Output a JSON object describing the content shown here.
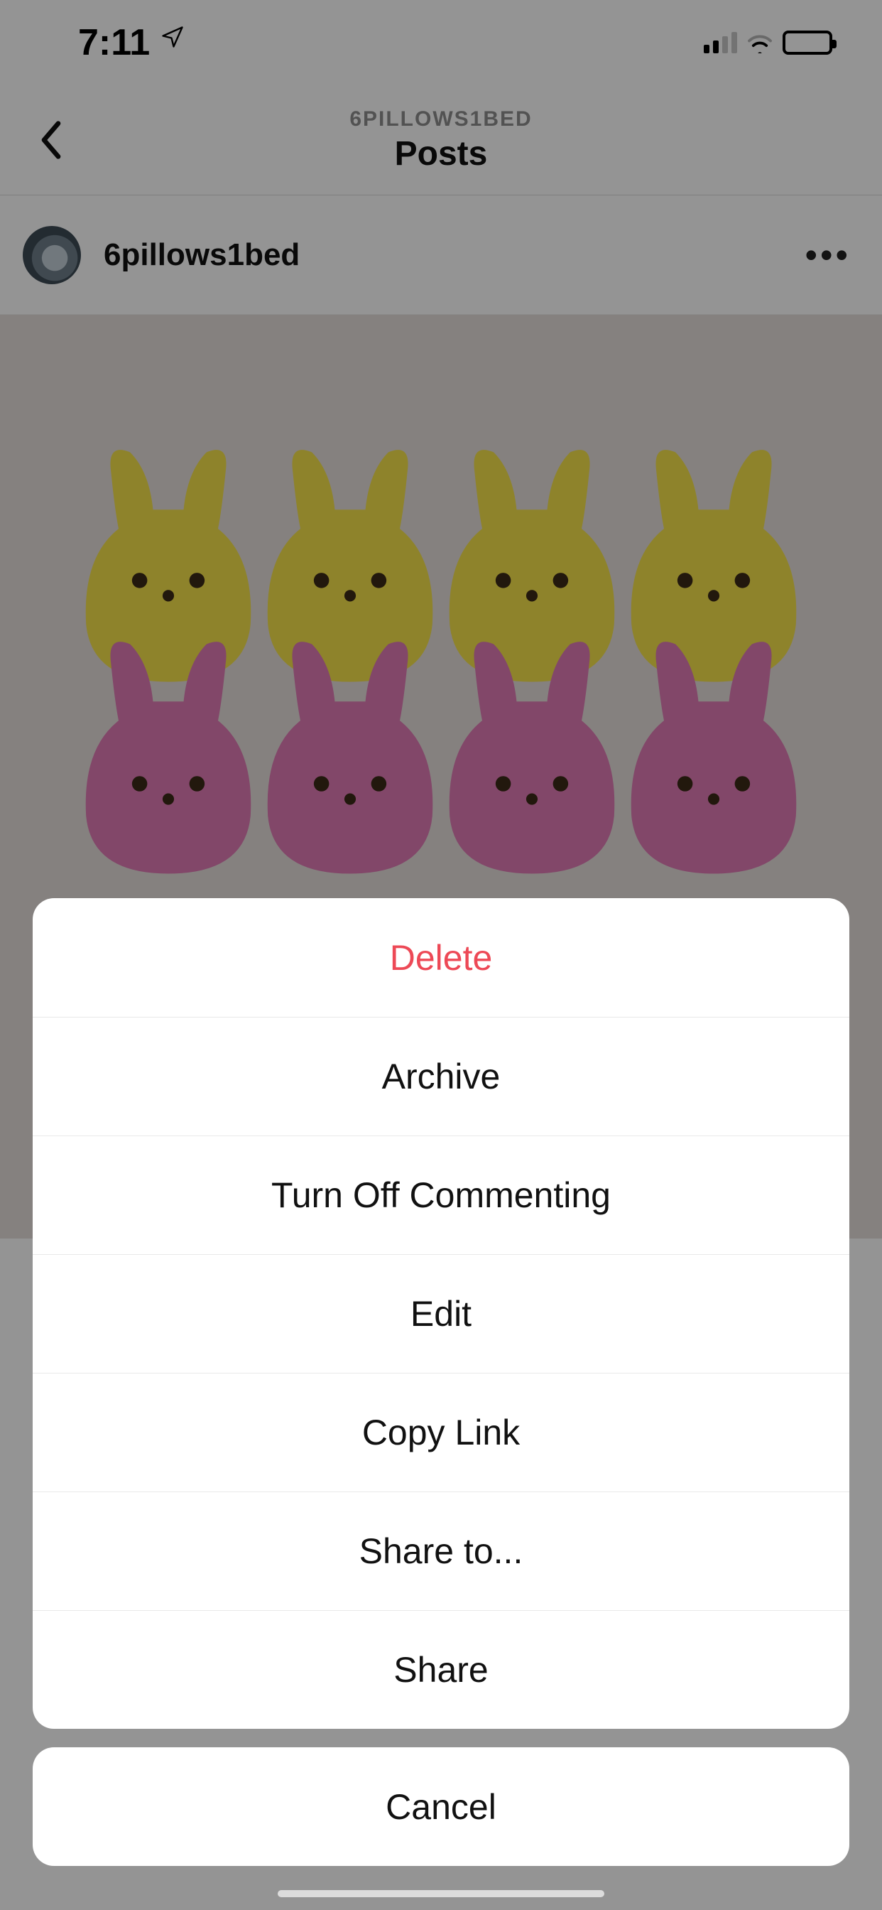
{
  "status_bar": {
    "time": "7:11"
  },
  "header": {
    "subtitle": "6PILLOWS1BED",
    "title": "Posts"
  },
  "post": {
    "username": "6pillows1bed"
  },
  "action_sheet": {
    "items": [
      {
        "label": "Delete",
        "destructive": true
      },
      {
        "label": "Archive",
        "destructive": false
      },
      {
        "label": "Turn Off Commenting",
        "destructive": false
      },
      {
        "label": "Edit",
        "destructive": false
      },
      {
        "label": "Copy Link",
        "destructive": false
      },
      {
        "label": "Share to...",
        "destructive": false
      },
      {
        "label": "Share",
        "destructive": false
      }
    ],
    "cancel_label": "Cancel"
  }
}
